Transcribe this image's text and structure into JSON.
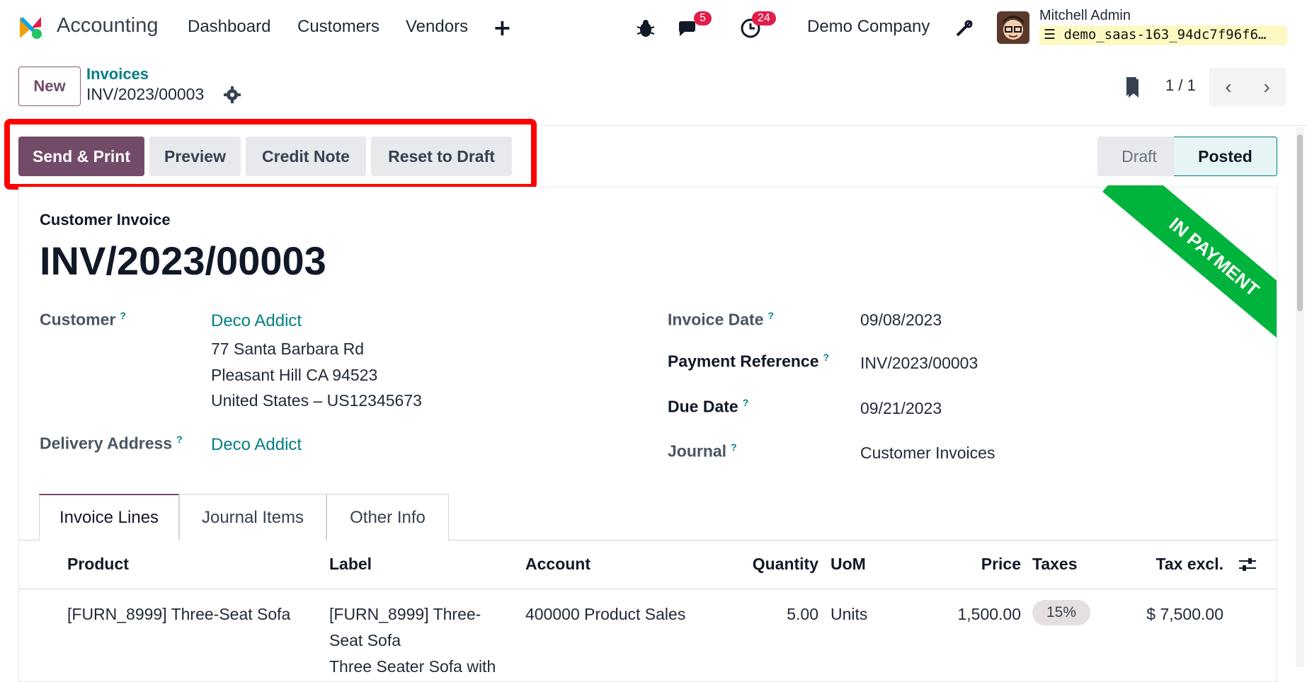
{
  "nav": {
    "app_name": "Accounting",
    "items": [
      "Dashboard",
      "Customers",
      "Vendors"
    ],
    "plus": "+",
    "messages_count": "5",
    "activities_count": "24",
    "company": "Demo Company",
    "user_name": "Mitchell Admin",
    "database": "demo_saas-163_94dc7f96f6…"
  },
  "control": {
    "new_label": "New",
    "breadcrumb_parent": "Invoices",
    "breadcrumb_current": "INV/2023/00003",
    "pager": "1 / 1",
    "prev": "‹",
    "next": "›"
  },
  "actions": {
    "send_print": "Send & Print",
    "preview": "Preview",
    "credit_note": "Credit Note",
    "reset_draft": "Reset to Draft"
  },
  "status": {
    "draft": "Draft",
    "posted": "Posted",
    "ribbon": "IN PAYMENT"
  },
  "invoice": {
    "type": "Customer Invoice",
    "number": "INV/2023/00003",
    "customer_label": "Customer",
    "customer_name": "Deco Addict",
    "address_line1": "77 Santa Barbara Rd",
    "address_line2": "Pleasant Hill CA 94523",
    "address_line3": "United States – US12345673",
    "delivery_label": "Delivery Address",
    "delivery_value": "Deco Addict",
    "invoice_date_label": "Invoice Date",
    "invoice_date": "09/08/2023",
    "payment_ref_label": "Payment Reference",
    "payment_ref": "INV/2023/00003",
    "due_date_label": "Due Date",
    "due_date": "09/21/2023",
    "journal_label": "Journal",
    "journal": "Customer Invoices",
    "qmark": "?"
  },
  "tabs": [
    "Invoice Lines",
    "Journal Items",
    "Other Info"
  ],
  "table": {
    "headers": [
      "Product",
      "Label",
      "Account",
      "Quantity",
      "UoM",
      "Price",
      "Taxes",
      "Tax excl."
    ],
    "row": {
      "product": "[FURN_8999] Three-Seat Sofa",
      "label_l1": "[FURN_8999] Three-",
      "label_l2": "Seat Sofa",
      "label_l3": "Three Seater Sofa with",
      "account": "400000 Product Sales",
      "quantity": "5.00",
      "uom": "Units",
      "price": "1,500.00",
      "taxes": "15%",
      "tax_excl": "$ 7,500.00"
    }
  },
  "colors": {
    "brand": "#714b67",
    "link": "#017e84",
    "highlight": "#ff0000",
    "ribbon": "#00b33c"
  }
}
